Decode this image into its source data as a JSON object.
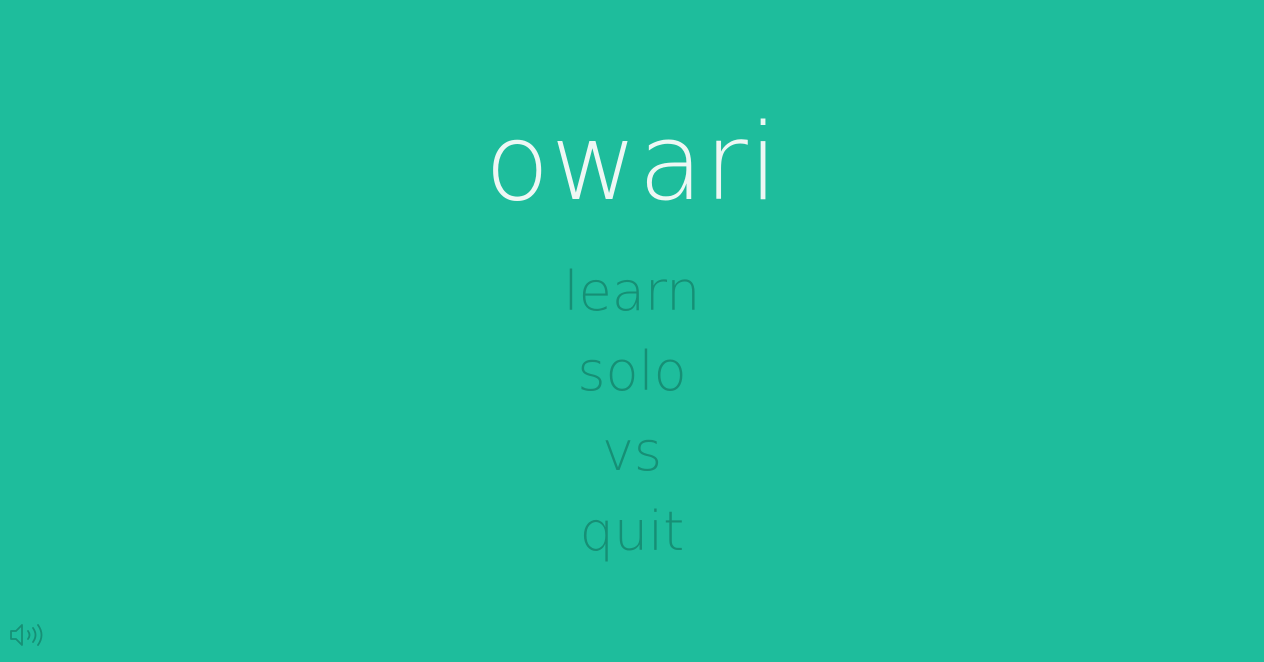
{
  "game": {
    "title": "owari"
  },
  "menu": {
    "items": [
      {
        "label": "learn"
      },
      {
        "label": "solo"
      },
      {
        "label": "vs"
      },
      {
        "label": "quit"
      }
    ]
  },
  "sound": {
    "icon": "speaker-icon"
  },
  "colors": {
    "background": "#1ebd9c",
    "title": "#eef7f4",
    "menu_text": "#168f75"
  }
}
